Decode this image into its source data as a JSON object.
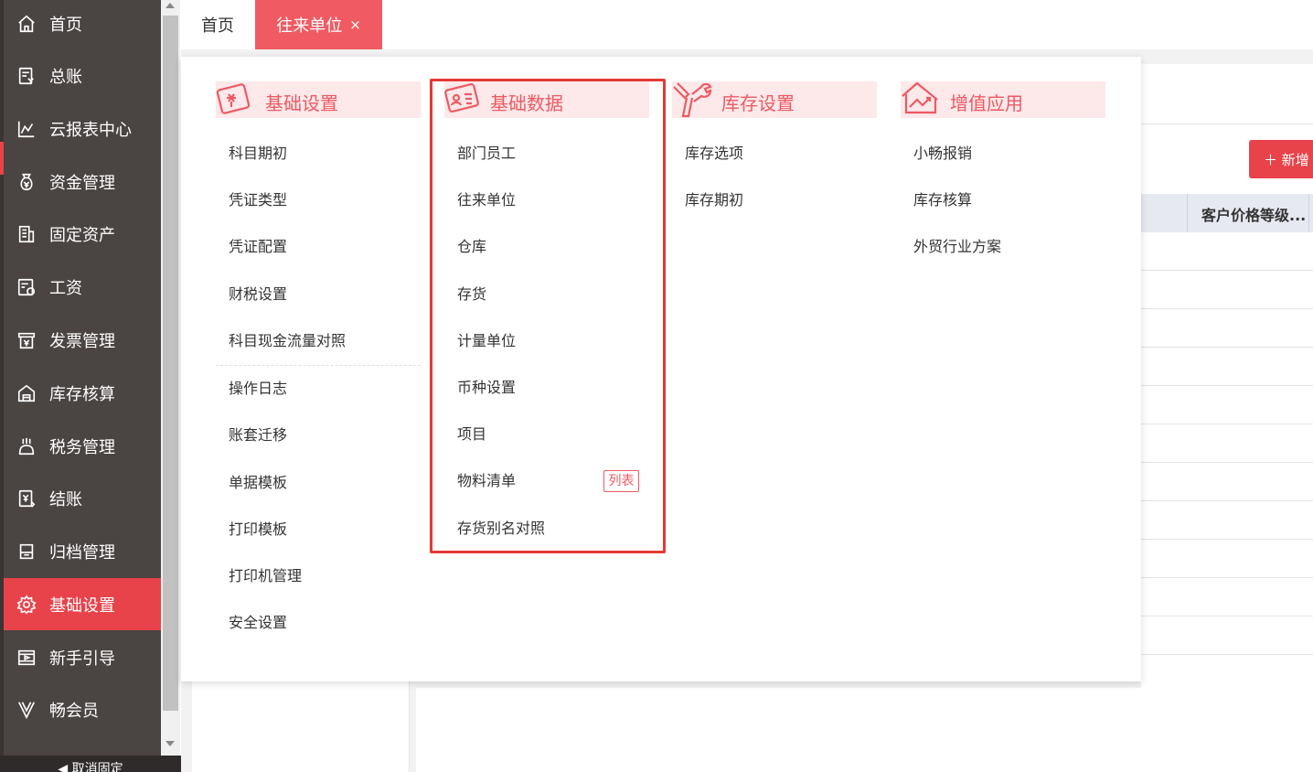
{
  "sidebar": {
    "items": [
      {
        "label": "首页",
        "icon": "home-icon"
      },
      {
        "label": "总账",
        "icon": "ledger-icon"
      },
      {
        "label": "云报表中心",
        "icon": "chart-icon"
      },
      {
        "label": "资金管理",
        "icon": "money-bag-icon"
      },
      {
        "label": "固定资产",
        "icon": "building-icon"
      },
      {
        "label": "工资",
        "icon": "payroll-icon"
      },
      {
        "label": "发票管理",
        "icon": "invoice-icon"
      },
      {
        "label": "库存核算",
        "icon": "warehouse-icon"
      },
      {
        "label": "税务管理",
        "icon": "tax-icon"
      },
      {
        "label": "结账",
        "icon": "checkout-icon"
      },
      {
        "label": "归档管理",
        "icon": "archive-icon"
      },
      {
        "label": "基础设置",
        "icon": "gear-icon",
        "active": true
      },
      {
        "label": "新手引导",
        "icon": "video-guide-icon"
      },
      {
        "label": "畅会员",
        "icon": "vip-icon"
      }
    ],
    "collapse_label": "◀ 取消固定"
  },
  "tabs": {
    "home": "首页",
    "active": "往来单位",
    "close_glyph": "×"
  },
  "background": {
    "add_button": "＋ 新增",
    "column_price_level": "客户价格等级..."
  },
  "menu": {
    "columns": [
      {
        "title": "基础设置",
        "icon": "settings-card-icon",
        "groups": [
          [
            "科目期初",
            "凭证类型",
            "凭证配置",
            "财税设置",
            "科目现金流量对照"
          ],
          [
            "操作日志",
            "账套迁移",
            "单据模板",
            "打印模板",
            "打印机管理",
            "安全设置"
          ]
        ]
      },
      {
        "title": "基础数据",
        "icon": "id-card-icon",
        "items": [
          "部门员工",
          "往来单位",
          "仓库",
          "存货",
          "计量单位",
          "币种设置",
          "项目",
          "物料清单",
          "存货别名对照"
        ],
        "bom_tag": "列表"
      },
      {
        "title": "库存设置",
        "icon": "wrench-icon",
        "items": [
          "库存选项",
          "库存期初"
        ]
      },
      {
        "title": "增值应用",
        "icon": "trend-box-icon",
        "items": [
          "小畅报销",
          "库存核算",
          "外贸行业方案"
        ]
      }
    ]
  },
  "colors": {
    "sidebar_bg": "#4a4442",
    "accent_red": "#e8424a",
    "menu_accent": "#ec5a63",
    "menu_head_bg": "#fde8ea",
    "highlight_border": "#e53935"
  }
}
